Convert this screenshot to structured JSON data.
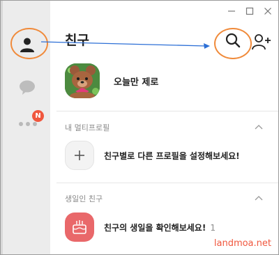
{
  "window": {
    "minimize": "—",
    "maximize": "☐",
    "close": "✕"
  },
  "sidebar": {
    "items": [
      {
        "name": "friends",
        "icon": "person-icon"
      },
      {
        "name": "chats",
        "icon": "chat-bubble-icon"
      },
      {
        "name": "more",
        "icon": "more-dots-icon",
        "badge": "N"
      }
    ]
  },
  "header": {
    "title": "친구",
    "search_icon": "search-icon",
    "add_friend_icon": "add-friend-icon"
  },
  "my_profile": {
    "name": "오늘만 제로"
  },
  "sections": [
    {
      "title": "내 멀티프로필",
      "row_text": "친구별로 다른 프로필을 설정해보세요!",
      "icon": "plus-icon"
    },
    {
      "title": "생일인 친구",
      "row_text": "친구의 생일을 확인해보세요!",
      "count": "1",
      "icon": "cake-icon"
    }
  ],
  "watermark": "landmoa.net",
  "colors": {
    "sidebar_bg": "#ececec",
    "annotation": "#f08a3a",
    "arrow": "#2c6fd6",
    "badge": "#f0573e",
    "cake_bg": "#e9686a"
  }
}
